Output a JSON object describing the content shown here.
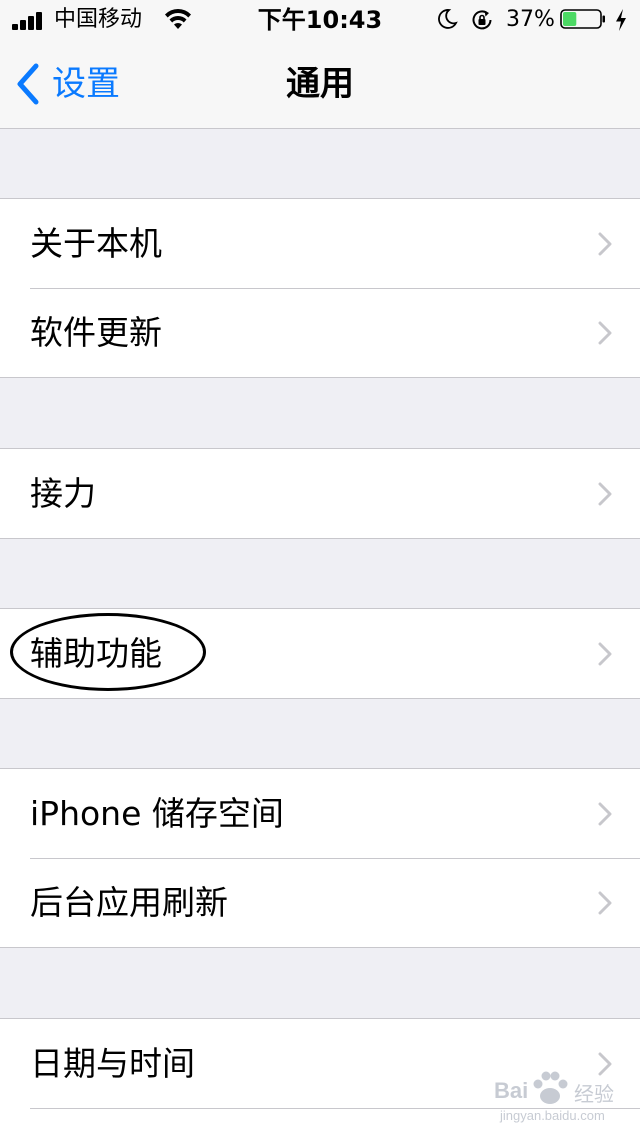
{
  "status_bar": {
    "carrier": "中国移动",
    "time": "下午10:43",
    "battery_percent": "37%",
    "battery_level": 0.37,
    "battery_color": "#4cd964"
  },
  "nav": {
    "back_label": "设置",
    "title": "通用",
    "accent_color": "#0a7aff"
  },
  "groups": [
    {
      "items": [
        {
          "label": "关于本机"
        },
        {
          "label": "软件更新"
        }
      ]
    },
    {
      "items": [
        {
          "label": "接力"
        }
      ]
    },
    {
      "items": [
        {
          "label": "辅助功能"
        }
      ]
    },
    {
      "items": [
        {
          "label": "iPhone 储存空间"
        },
        {
          "label": "后台应用刷新"
        }
      ]
    },
    {
      "items": [
        {
          "label": "日期与时间"
        }
      ]
    }
  ],
  "watermark": {
    "brand": "Bai",
    "brand_suffix": "经验",
    "url": "jingyan.baidu.com"
  }
}
